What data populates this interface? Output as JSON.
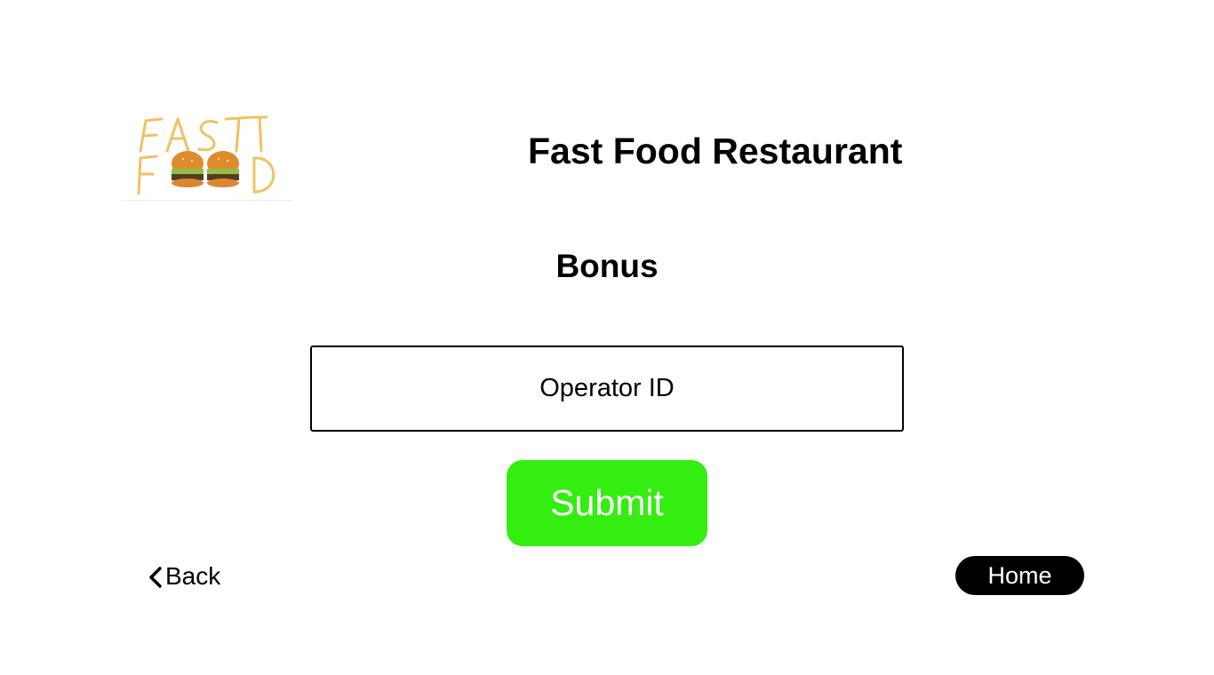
{
  "logo": {
    "alt": "FAST FOOD",
    "line1": "FAST",
    "line2_start": "F",
    "line2_end": "D",
    "colors": {
      "fries": "#f2c96a",
      "bun": "#e08a2e",
      "patty": "#5a3a22",
      "lettuce": "#8fc04a"
    }
  },
  "header": {
    "title": "Fast Food Restaurant"
  },
  "main": {
    "title": "Bonus",
    "operator_field": {
      "placeholder": "Operator ID",
      "value": ""
    },
    "submit_label": "Submit"
  },
  "nav": {
    "back_label": "Back",
    "back_icon": "chevron-left-icon",
    "home_label": "Home"
  },
  "colors": {
    "submit_bg": "#33ee10",
    "home_bg": "#000000",
    "text": "#000000"
  }
}
